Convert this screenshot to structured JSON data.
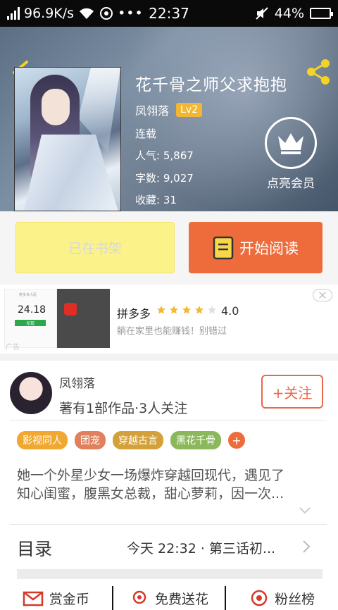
{
  "status_bar": {
    "network_speed": "96.9K/s",
    "time": "22:37",
    "battery": "44%",
    "battery_level": 0.44
  },
  "book": {
    "title": "花千骨之师父求抱抱",
    "author": "凤翎落",
    "level": "Lv2",
    "status": "连载",
    "popularity_label": "人气:",
    "popularity": "5,867",
    "words_label": "字数:",
    "words": "9,027",
    "favorites_label": "收藏:",
    "favorites": "31",
    "vip_label": "点亮会员"
  },
  "actions": {
    "shelf_label": "已在书架",
    "read_label": "开始阅读"
  },
  "ad": {
    "title": "拼多多",
    "rating": "4.0",
    "rating_value": 4.0,
    "description": "躺在家里也能赚钱！别错过",
    "tag": "广告",
    "thumb_amount": "24.18",
    "thumb_brand": "拼多多人民",
    "thumb_button": "兑现"
  },
  "author_section": {
    "name": "凤翎落",
    "info": "著有1部作品·3人关注",
    "follow_label": "+关注",
    "tags": [
      {
        "label": "影视同人",
        "color": "#f0a830"
      },
      {
        "label": "团宠",
        "color": "#e0805c"
      },
      {
        "label": "穿越古言",
        "color": "#d4a03a"
      },
      {
        "label": "黑花千骨",
        "color": "#8bb85a"
      }
    ],
    "tag_more": "+",
    "description_line1": "她一个外星少女一场爆炸穿越回现代，遇见了",
    "description_line2": "知心闺蜜，腹黑女总裁，甜心萝莉，因一次..."
  },
  "toc": {
    "label": "目录",
    "latest": "今天 22:32 · 第三话初..."
  },
  "bottom_bar": {
    "reward_label": "赏金币",
    "flower_label": "免费送花",
    "fans_label": "粉丝榜"
  },
  "colors": {
    "accent": "#ee6c3c",
    "shelf_bg": "#fbf38a",
    "level_badge": "#f2b632"
  }
}
